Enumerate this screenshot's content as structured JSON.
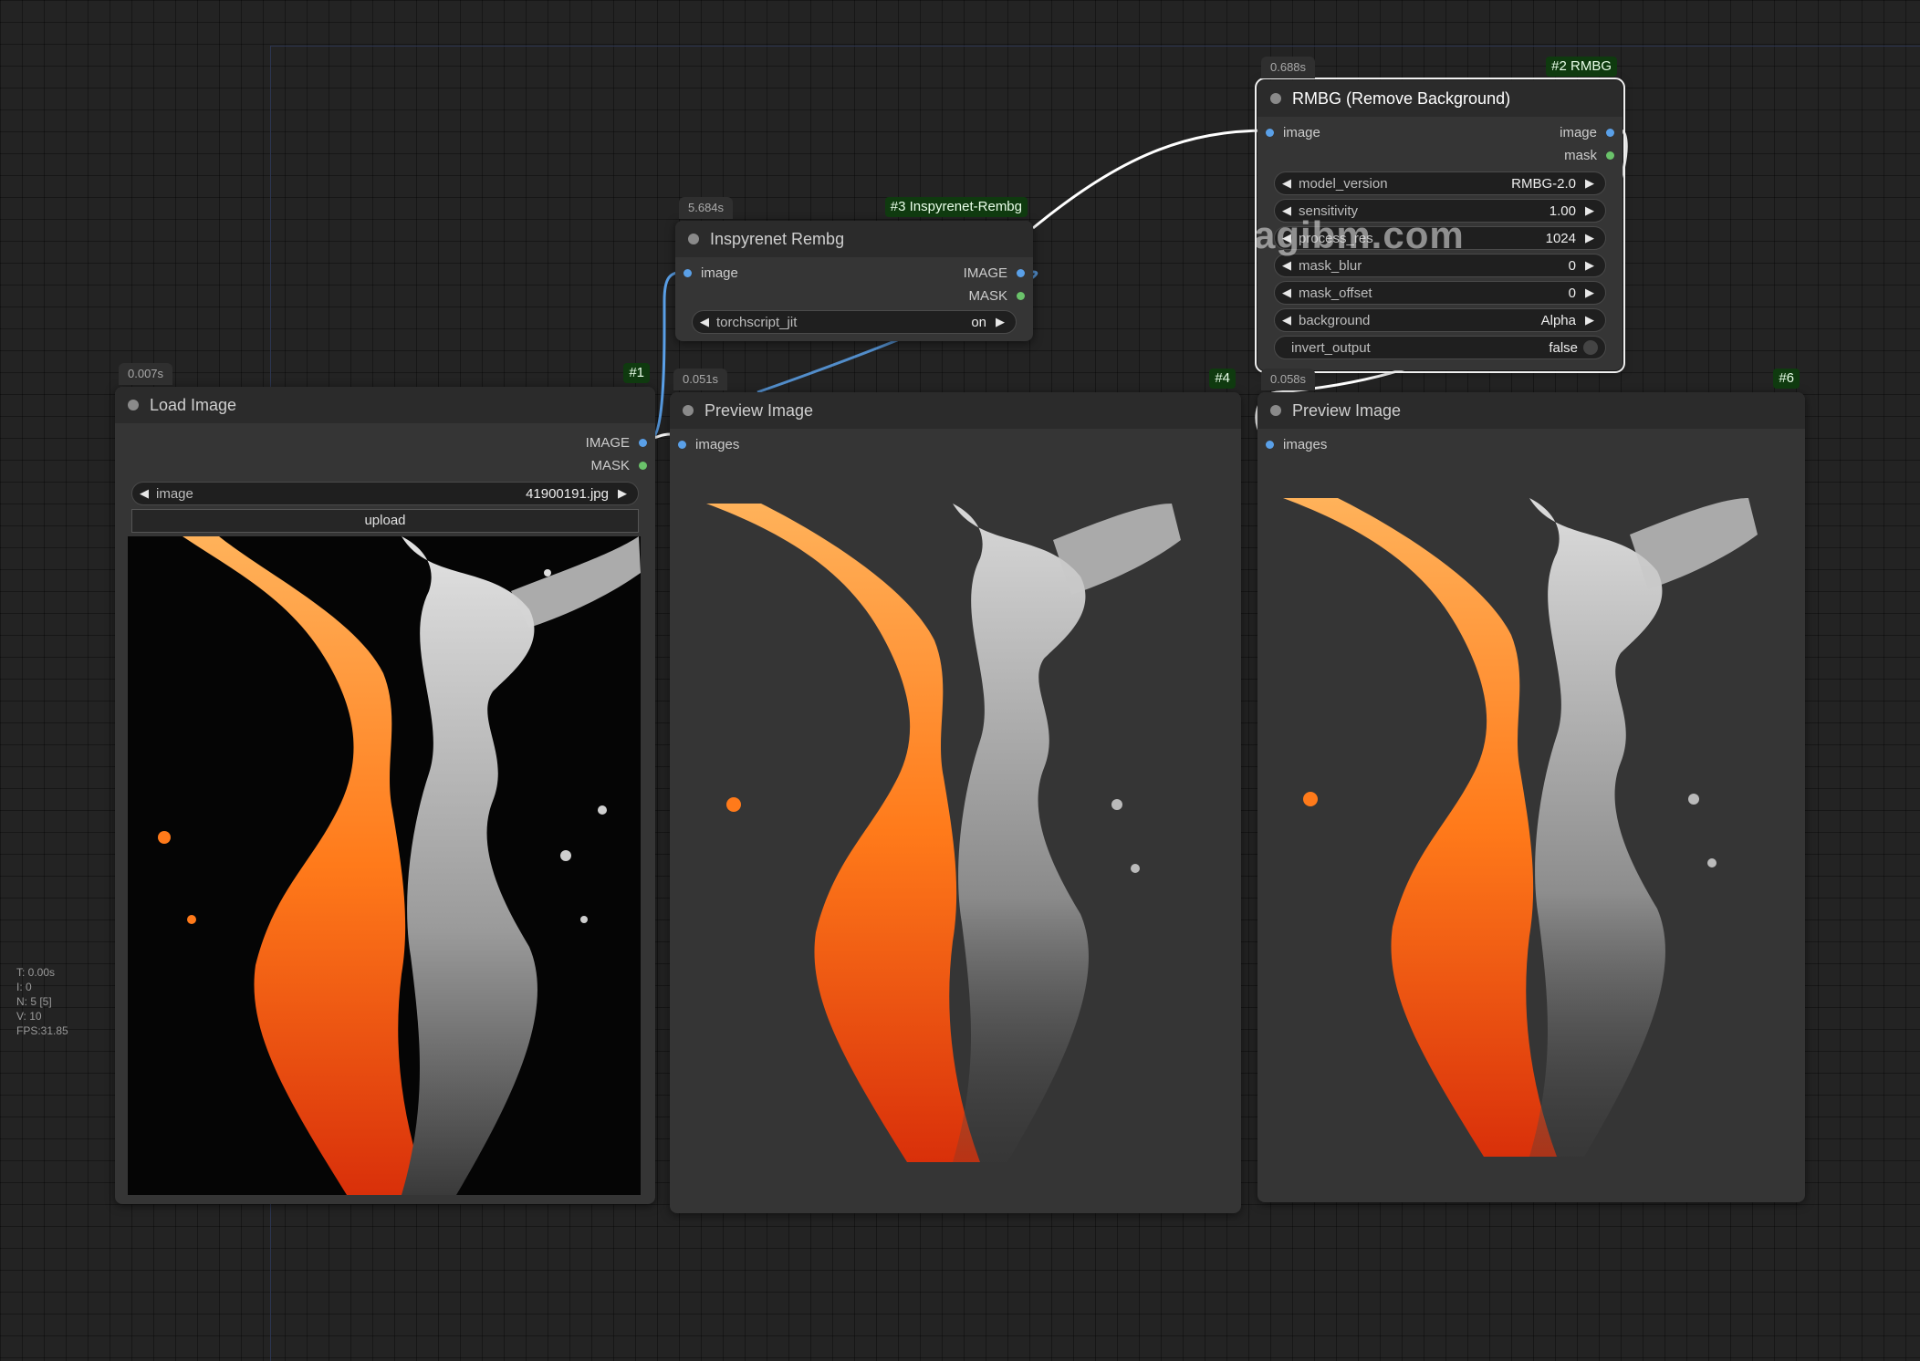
{
  "canvas": {
    "stats": {
      "t": "T: 0.00s",
      "i": "I: 0",
      "n": "N: 5 [5]",
      "v": "V: 10",
      "fps": "FPS:31.85"
    },
    "watermark": "agibm.com"
  },
  "nodes": {
    "load_image": {
      "id_badge": "#1",
      "timing": "0.007s",
      "title": "Load Image",
      "outputs": [
        "IMAGE",
        "MASK"
      ],
      "widget_image": {
        "name": "image",
        "value": "41900191.jpg"
      },
      "upload_label": "upload"
    },
    "inspyrenet": {
      "id_badge": "#3 Inspyrenet-Rembg",
      "timing": "5.684s",
      "title": "Inspyrenet Rembg",
      "input": "image",
      "outputs": [
        "IMAGE",
        "MASK"
      ],
      "widget": {
        "name": "torchscript_jit",
        "value": "on"
      }
    },
    "rmbg": {
      "id_badge": "#2 RMBG",
      "timing": "0.688s",
      "title": "RMBG (Remove Background)",
      "input": "image",
      "outputs": [
        "image",
        "mask"
      ],
      "widgets": [
        {
          "name": "model_version",
          "value": "RMBG-2.0"
        },
        {
          "name": "sensitivity",
          "value": "1.00"
        },
        {
          "name": "process_res",
          "value": "1024"
        },
        {
          "name": "mask_blur",
          "value": "0"
        },
        {
          "name": "mask_offset",
          "value": "0"
        },
        {
          "name": "background",
          "value": "Alpha"
        }
      ],
      "toggle": {
        "name": "invert_output",
        "value": "false"
      }
    },
    "preview_4": {
      "id_badge": "#4",
      "timing": "0.051s",
      "title": "Preview Image",
      "input": "images"
    },
    "preview_6": {
      "id_badge": "#6",
      "timing": "0.058s",
      "title": "Preview Image",
      "input": "images"
    }
  },
  "colors": {
    "image_slot": "#5aa0e8",
    "mask_slot": "#6ac26a",
    "badge_bg": "#0f3a0f",
    "wire": "#ffffff",
    "wire_image": "#5aa0e8"
  }
}
